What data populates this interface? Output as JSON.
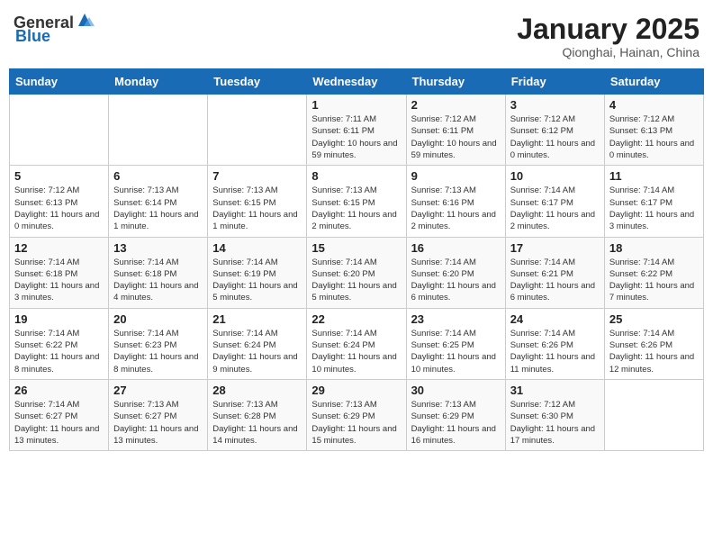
{
  "header": {
    "logo_general": "General",
    "logo_blue": "Blue",
    "month_title": "January 2025",
    "subtitle": "Qionghai, Hainan, China"
  },
  "days_of_week": [
    "Sunday",
    "Monday",
    "Tuesday",
    "Wednesday",
    "Thursday",
    "Friday",
    "Saturday"
  ],
  "weeks": [
    [
      {
        "day": "",
        "info": ""
      },
      {
        "day": "",
        "info": ""
      },
      {
        "day": "",
        "info": ""
      },
      {
        "day": "1",
        "info": "Sunrise: 7:11 AM\nSunset: 6:11 PM\nDaylight: 10 hours and 59 minutes."
      },
      {
        "day": "2",
        "info": "Sunrise: 7:12 AM\nSunset: 6:11 PM\nDaylight: 10 hours and 59 minutes."
      },
      {
        "day": "3",
        "info": "Sunrise: 7:12 AM\nSunset: 6:12 PM\nDaylight: 11 hours and 0 minutes."
      },
      {
        "day": "4",
        "info": "Sunrise: 7:12 AM\nSunset: 6:13 PM\nDaylight: 11 hours and 0 minutes."
      }
    ],
    [
      {
        "day": "5",
        "info": "Sunrise: 7:12 AM\nSunset: 6:13 PM\nDaylight: 11 hours and 0 minutes."
      },
      {
        "day": "6",
        "info": "Sunrise: 7:13 AM\nSunset: 6:14 PM\nDaylight: 11 hours and 1 minute."
      },
      {
        "day": "7",
        "info": "Sunrise: 7:13 AM\nSunset: 6:15 PM\nDaylight: 11 hours and 1 minute."
      },
      {
        "day": "8",
        "info": "Sunrise: 7:13 AM\nSunset: 6:15 PM\nDaylight: 11 hours and 2 minutes."
      },
      {
        "day": "9",
        "info": "Sunrise: 7:13 AM\nSunset: 6:16 PM\nDaylight: 11 hours and 2 minutes."
      },
      {
        "day": "10",
        "info": "Sunrise: 7:14 AM\nSunset: 6:17 PM\nDaylight: 11 hours and 2 minutes."
      },
      {
        "day": "11",
        "info": "Sunrise: 7:14 AM\nSunset: 6:17 PM\nDaylight: 11 hours and 3 minutes."
      }
    ],
    [
      {
        "day": "12",
        "info": "Sunrise: 7:14 AM\nSunset: 6:18 PM\nDaylight: 11 hours and 3 minutes."
      },
      {
        "day": "13",
        "info": "Sunrise: 7:14 AM\nSunset: 6:18 PM\nDaylight: 11 hours and 4 minutes."
      },
      {
        "day": "14",
        "info": "Sunrise: 7:14 AM\nSunset: 6:19 PM\nDaylight: 11 hours and 5 minutes."
      },
      {
        "day": "15",
        "info": "Sunrise: 7:14 AM\nSunset: 6:20 PM\nDaylight: 11 hours and 5 minutes."
      },
      {
        "day": "16",
        "info": "Sunrise: 7:14 AM\nSunset: 6:20 PM\nDaylight: 11 hours and 6 minutes."
      },
      {
        "day": "17",
        "info": "Sunrise: 7:14 AM\nSunset: 6:21 PM\nDaylight: 11 hours and 6 minutes."
      },
      {
        "day": "18",
        "info": "Sunrise: 7:14 AM\nSunset: 6:22 PM\nDaylight: 11 hours and 7 minutes."
      }
    ],
    [
      {
        "day": "19",
        "info": "Sunrise: 7:14 AM\nSunset: 6:22 PM\nDaylight: 11 hours and 8 minutes."
      },
      {
        "day": "20",
        "info": "Sunrise: 7:14 AM\nSunset: 6:23 PM\nDaylight: 11 hours and 8 minutes."
      },
      {
        "day": "21",
        "info": "Sunrise: 7:14 AM\nSunset: 6:24 PM\nDaylight: 11 hours and 9 minutes."
      },
      {
        "day": "22",
        "info": "Sunrise: 7:14 AM\nSunset: 6:24 PM\nDaylight: 11 hours and 10 minutes."
      },
      {
        "day": "23",
        "info": "Sunrise: 7:14 AM\nSunset: 6:25 PM\nDaylight: 11 hours and 10 minutes."
      },
      {
        "day": "24",
        "info": "Sunrise: 7:14 AM\nSunset: 6:26 PM\nDaylight: 11 hours and 11 minutes."
      },
      {
        "day": "25",
        "info": "Sunrise: 7:14 AM\nSunset: 6:26 PM\nDaylight: 11 hours and 12 minutes."
      }
    ],
    [
      {
        "day": "26",
        "info": "Sunrise: 7:14 AM\nSunset: 6:27 PM\nDaylight: 11 hours and 13 minutes."
      },
      {
        "day": "27",
        "info": "Sunrise: 7:13 AM\nSunset: 6:27 PM\nDaylight: 11 hours and 13 minutes."
      },
      {
        "day": "28",
        "info": "Sunrise: 7:13 AM\nSunset: 6:28 PM\nDaylight: 11 hours and 14 minutes."
      },
      {
        "day": "29",
        "info": "Sunrise: 7:13 AM\nSunset: 6:29 PM\nDaylight: 11 hours and 15 minutes."
      },
      {
        "day": "30",
        "info": "Sunrise: 7:13 AM\nSunset: 6:29 PM\nDaylight: 11 hours and 16 minutes."
      },
      {
        "day": "31",
        "info": "Sunrise: 7:12 AM\nSunset: 6:30 PM\nDaylight: 11 hours and 17 minutes."
      },
      {
        "day": "",
        "info": ""
      }
    ]
  ]
}
